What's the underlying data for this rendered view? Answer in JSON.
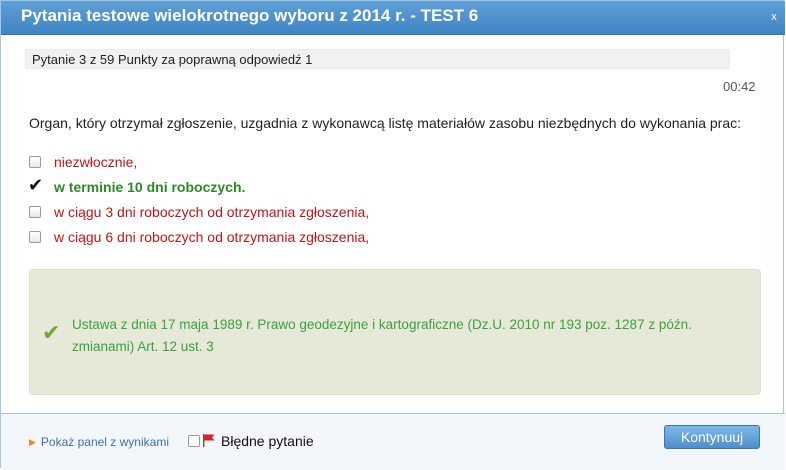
{
  "window": {
    "title": "Pytania testowe wielokrotnego wyboru z 2014 r. - TEST 6",
    "close_icon": "x"
  },
  "progress": {
    "text": "Pytanie 3 z 59 Punkty za poprawną odpowiedź 1",
    "question_number": 3,
    "total_questions": 59
  },
  "timer": "00:42",
  "question": "Organ, który otrzymał zgłoszenie, uzgadnia z wykonawcą listę materiałów zasobu niezbędnych do wykonania prac:",
  "answers": [
    {
      "label": "niezwłocznie,",
      "correct": false
    },
    {
      "label": "w terminie 10 dni roboczych.",
      "correct": true
    },
    {
      "label": "w ciągu 3 dni roboczych od otrzymania zgłoszenia,",
      "correct": false
    },
    {
      "label": "w ciągu 6 dni roboczych od otrzymania zgłoszenia,",
      "correct": false
    }
  ],
  "explanation": {
    "text": "Ustawa z dnia 17 maja 1989 r. Prawo geodezyjne i kartograficzne (Dz.U. 2010 nr 193 poz. 1287 z późn. zmianami) Art. 12 ust. 3",
    "icon": "check-icon"
  },
  "footer": {
    "panel_link": "Pokaż panel z wynikami",
    "flag_label": "Błędne pytanie",
    "continue_label": "Kontynuuj"
  },
  "colors": {
    "title_bar": "#4a8fcf",
    "wrong_answer": "#c0141a",
    "correct_answer": "#2a8a24",
    "explanation_bg": "#e6e8d8",
    "explanation_text": "#3aa33a",
    "flag": "#d8232a"
  }
}
